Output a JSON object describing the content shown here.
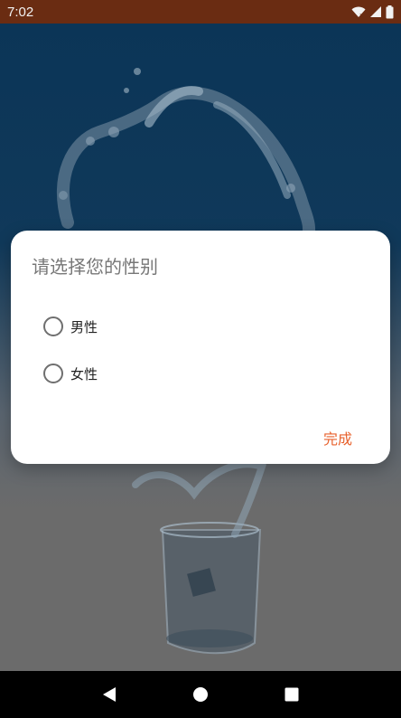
{
  "status_bar": {
    "time": "7:02"
  },
  "dialog": {
    "title": "请选择您的性别",
    "options": [
      {
        "label": "男性",
        "selected": false
      },
      {
        "label": "女性",
        "selected": false
      }
    ],
    "done_label": "完成"
  },
  "colors": {
    "status_bar": "#6a2c12",
    "accent": "#e8622d",
    "nav_bar": "#000000"
  },
  "icons": {
    "status": [
      "wifi-icon",
      "signal-icon",
      "battery-icon"
    ],
    "nav": [
      "back-icon",
      "home-icon",
      "recents-icon"
    ]
  }
}
